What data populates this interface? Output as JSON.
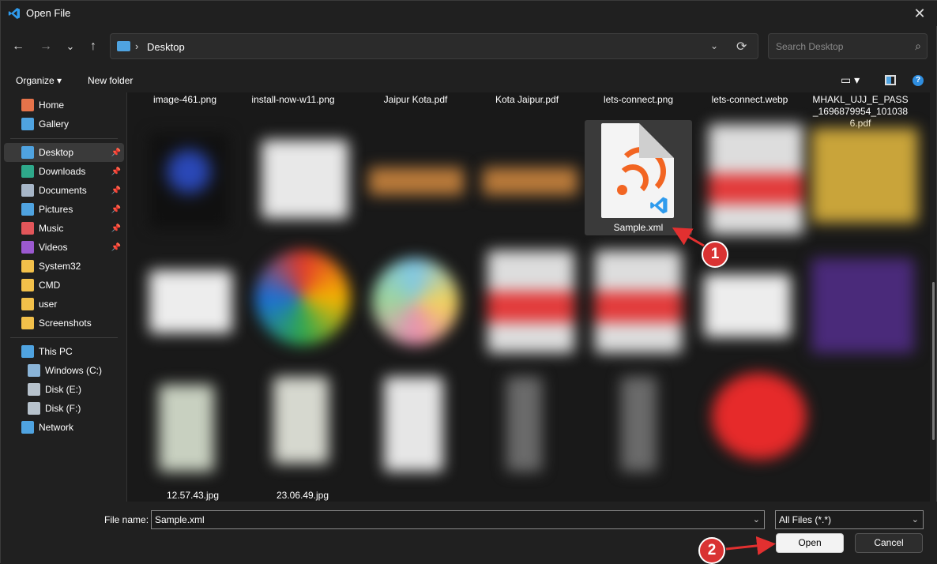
{
  "window": {
    "title": "Open File",
    "close_glyph": "✕"
  },
  "nav": {
    "back": "←",
    "forward": "→",
    "recent": "⌄",
    "up": "↑"
  },
  "address": {
    "separator": "›",
    "crumb": "Desktop",
    "dropdown": "⌄",
    "refresh": "⟳"
  },
  "search": {
    "placeholder": "Search Desktop",
    "icon": "⌕"
  },
  "commands": {
    "organize": "Organize ▾",
    "new_folder": "New folder",
    "view": "▭ ▾",
    "help": "?"
  },
  "sidebar": {
    "quick": [
      {
        "label": "Home",
        "icon": "home-icon",
        "color": "#e6734a"
      },
      {
        "label": "Gallery",
        "icon": "gallery-icon",
        "color": "#4fa3e0"
      }
    ],
    "pinned": [
      {
        "label": "Desktop",
        "icon": "desktop-icon",
        "color": "#4fa3e0",
        "pin": "📌"
      },
      {
        "label": "Downloads",
        "icon": "download-icon",
        "color": "#2ea88a",
        "pin": "📌"
      },
      {
        "label": "Documents",
        "icon": "document-icon",
        "color": "#a7b6c8",
        "pin": "📌"
      },
      {
        "label": "Pictures",
        "icon": "pictures-icon",
        "color": "#4fa3e0",
        "pin": "📌"
      },
      {
        "label": "Music",
        "icon": "music-icon",
        "color": "#e2565a",
        "pin": "📌"
      },
      {
        "label": "Videos",
        "icon": "videos-icon",
        "color": "#9b59d0",
        "pin": "📌"
      },
      {
        "label": "System32",
        "icon": "folder-icon",
        "color": "#f2c04a"
      },
      {
        "label": "CMD",
        "icon": "folder-icon",
        "color": "#f2c04a"
      },
      {
        "label": "user",
        "icon": "folder-icon",
        "color": "#f2c04a"
      },
      {
        "label": "Screenshots",
        "icon": "folder-icon",
        "color": "#f2c04a"
      }
    ],
    "pc": [
      {
        "label": "This PC",
        "icon": "pc-icon",
        "color": "#4fa3e0"
      },
      {
        "label": "Windows (C:)",
        "icon": "drive-icon",
        "color": "#8ab4d8"
      },
      {
        "label": "Disk (E:)",
        "icon": "drive-icon",
        "color": "#b7c2cc"
      },
      {
        "label": "Disk (F:)",
        "icon": "drive-icon",
        "color": "#b7c2cc"
      },
      {
        "label": "Network",
        "icon": "network-icon",
        "color": "#4fa3e0"
      }
    ]
  },
  "files": {
    "row1": [
      "image-461.png",
      "install-now-w11.png",
      "Jaipur Kota.pdf",
      "Kota Jaipur.pdf",
      "lets-connect.png",
      "lets-connect.webp",
      "MHAKL_UJJ_E_PASS_1696879954_1010386.pdf"
    ],
    "selected": "Sample.xml",
    "bottom": [
      "12.57.43.jpg",
      "23.06.49.jpg"
    ]
  },
  "footer": {
    "file_name_label": "File name:",
    "file_name_value": "Sample.xml",
    "file_type": "All Files (*.*)",
    "dd": "⌄",
    "open": "Open",
    "cancel": "Cancel"
  },
  "annotations": {
    "step1": "1",
    "step2": "2"
  }
}
